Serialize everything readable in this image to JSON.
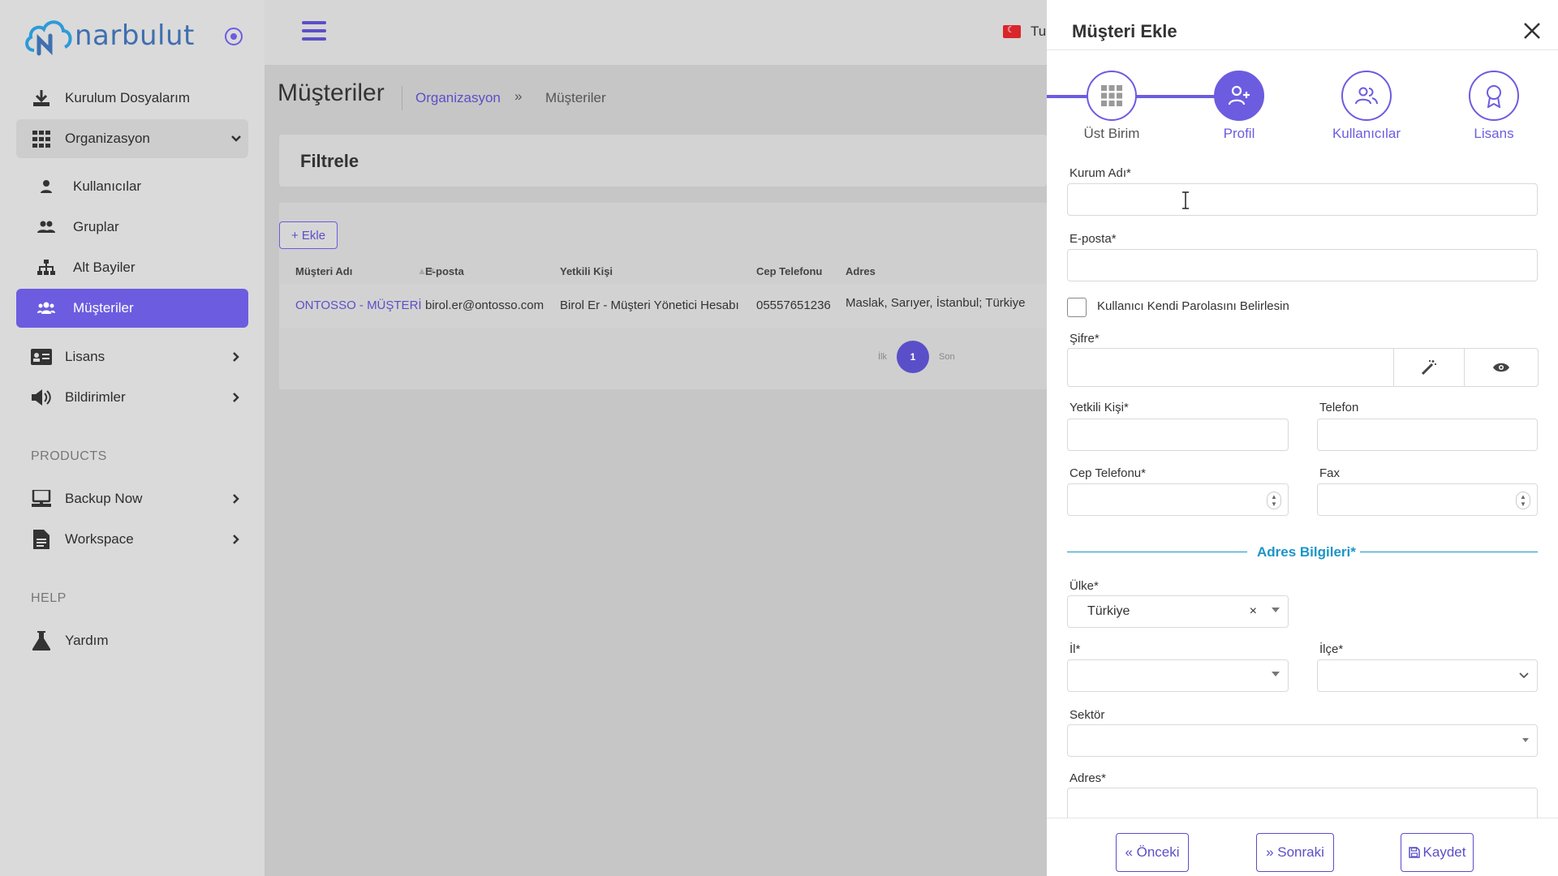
{
  "app": {
    "logo_text": "narbulut"
  },
  "sidebar": {
    "items": [
      {
        "label": "Kurulum Dosyalarım"
      },
      {
        "label": "Organizasyon"
      },
      {
        "label": "Kullanıcılar"
      },
      {
        "label": "Gruplar"
      },
      {
        "label": "Alt Bayiler"
      },
      {
        "label": "Müşteriler"
      },
      {
        "label": "Lisans"
      },
      {
        "label": "Bildirimler"
      },
      {
        "label": "Backup Now"
      },
      {
        "label": "Workspace"
      },
      {
        "label": "Yardım"
      }
    ],
    "section_products": "PRODUCTS",
    "section_help": "HELP"
  },
  "topbar": {
    "language": "Tu"
  },
  "main": {
    "title": "Müşteriler",
    "breadcrumb": [
      "Organizasyon",
      "»",
      "Müşteriler"
    ],
    "filter_title": "Filtrele",
    "add_button": "+ Ekle",
    "table": {
      "headers": [
        "Müşteri Adı",
        "E-posta",
        "Yetkili Kişi",
        "Cep Telefonu",
        "Adres"
      ],
      "rows": [
        [
          "ONTOSSO - MÜŞTERİ",
          "birol.er@ontosso.com",
          "Birol Er - Müşteri Yönetici Hesabı",
          "05557651236",
          "Maslak, Sarıyer, İstanbul; Türkiye"
        ]
      ]
    },
    "pager": {
      "first": "İlk",
      "current": "1",
      "last": "Son"
    }
  },
  "drawer": {
    "title": "Müşteri Ekle",
    "steps": [
      "Üst Birim",
      "Profil",
      "Kullanıcılar",
      "Lisans"
    ],
    "fields": {
      "kurum_adi": "Kurum Adı*",
      "eposta": "E-posta*",
      "checkbox": "Kullanıcı Kendi Parolasını Belirlesin",
      "sifre": "Şifre*",
      "yetkili": "Yetkili Kişi*",
      "telefon": "Telefon",
      "cep": "Cep Telefonu*",
      "fax": "Fax",
      "adres_bilgileri": "Adres Bilgileri*",
      "ulke": "Ülke*",
      "ulke_value": "Türkiye",
      "il": "İl*",
      "ilce": "İlçe*",
      "sektor": "Sektör",
      "adres": "Adres*"
    },
    "buttons": {
      "prev": "« Önceki",
      "next": "» Sonraki",
      "save": "Kaydet"
    }
  },
  "colors": {
    "accent": "#6c5ce0",
    "divider": "#1a95c8"
  }
}
